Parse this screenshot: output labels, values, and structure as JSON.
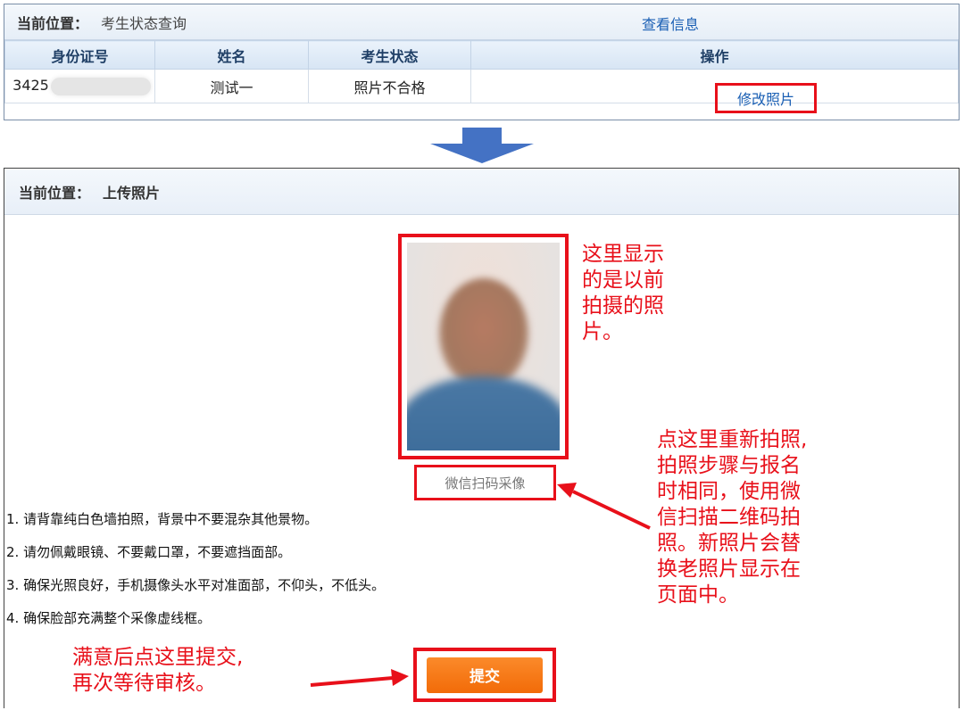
{
  "top_panel": {
    "breadcrumb_label": "当前位置：",
    "breadcrumb_value": "考生状态查询",
    "columns": [
      "身份证号",
      "姓名",
      "考生状态",
      "操作"
    ],
    "row": {
      "id_prefix": "3425",
      "name": "测试一",
      "status": "照片不合格",
      "action_view": "查看信息",
      "action_edit": "修改照片"
    }
  },
  "upload_panel": {
    "breadcrumb_label": "当前位置：",
    "breadcrumb_value": "上传照片",
    "scan_label": "微信扫码采像",
    "rules": [
      "1. 请背靠纯白色墙拍照，背景中不要混杂其他景物。",
      "2. 请勿佩戴眼镜、不要戴口罩，不要遮挡面部。",
      "3. 确保光照良好，手机摄像头水平对准面部，不仰头，不低头。",
      "4. 确保脸部充满整个采像虚线框。"
    ],
    "submit_label": "提交"
  },
  "annotations": {
    "previous_photo": [
      "这里显示",
      "的是以前",
      "拍摄的照",
      "片。"
    ],
    "rescan": [
      "点这里重新拍照,",
      "拍照步骤与报名",
      "时相同，使用微",
      "信扫描二维码拍",
      "照。新照片会替",
      "换老照片显示在",
      "页面中。"
    ],
    "submit": [
      "满意后点这里提交,",
      "再次等待审核。"
    ]
  },
  "colors": {
    "highlight": "#e8101a",
    "link": "#1a5fb4",
    "submit_button": "#f57a16",
    "flow_arrow": "#4472c4"
  }
}
